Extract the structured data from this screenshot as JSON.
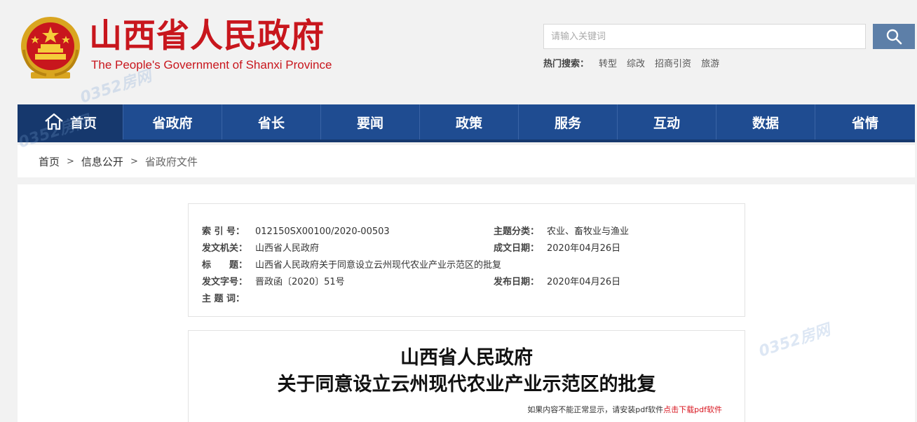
{
  "header": {
    "title": "山西省人民政府",
    "subtitle": "The People's Government of Shanxi Province"
  },
  "search": {
    "placeholder": "请输入关键词",
    "hot_label": "热门搜索：",
    "hot_terms": [
      "转型",
      "综改",
      "招商引资",
      "旅游"
    ]
  },
  "nav": {
    "items": [
      "首页",
      "省政府",
      "省长",
      "要闻",
      "政策",
      "服务",
      "互动",
      "数据",
      "省情"
    ]
  },
  "breadcrumb": {
    "items": [
      "首页",
      "信息公开",
      "省政府文件"
    ],
    "separator": ">"
  },
  "meta": {
    "index_label": "索 引 号：",
    "index_value": "012150SX00100/2020-00503",
    "topic_label": "主题分类：",
    "topic_value": "农业、畜牧业与渔业",
    "issuer_label": "发文机关：",
    "issuer_value": "山西省人民政府",
    "created_label": "成文日期：",
    "created_value": "2020年04月26日",
    "title_label": "标　　题：",
    "title_value": "山西省人民政府关于同意设立云州现代农业产业示范区的批复",
    "docno_label": "发文字号：",
    "docno_value": "晋政函〔2020〕51号",
    "published_label": "发布日期：",
    "published_value": "2020年04月26日",
    "keywords_label": "主 题 词：",
    "keywords_value": ""
  },
  "document": {
    "title_line1": "山西省人民政府",
    "title_line2": "关于同意设立云州现代农业产业示范区的批复",
    "pdf_tip": "如果内容不能正常显示，请安装pdf软件",
    "pdf_link": "点击下载pdf软件"
  },
  "watermark": {
    "text": "0352房网"
  },
  "colors": {
    "brand_red": "#c8161d",
    "nav_blue": "#1f4c91",
    "nav_dark": "#16386d",
    "search_button": "#5d7fa8"
  },
  "icons": {
    "emblem": "national-emblem-icon",
    "search": "search-icon",
    "home": "home-icon"
  }
}
